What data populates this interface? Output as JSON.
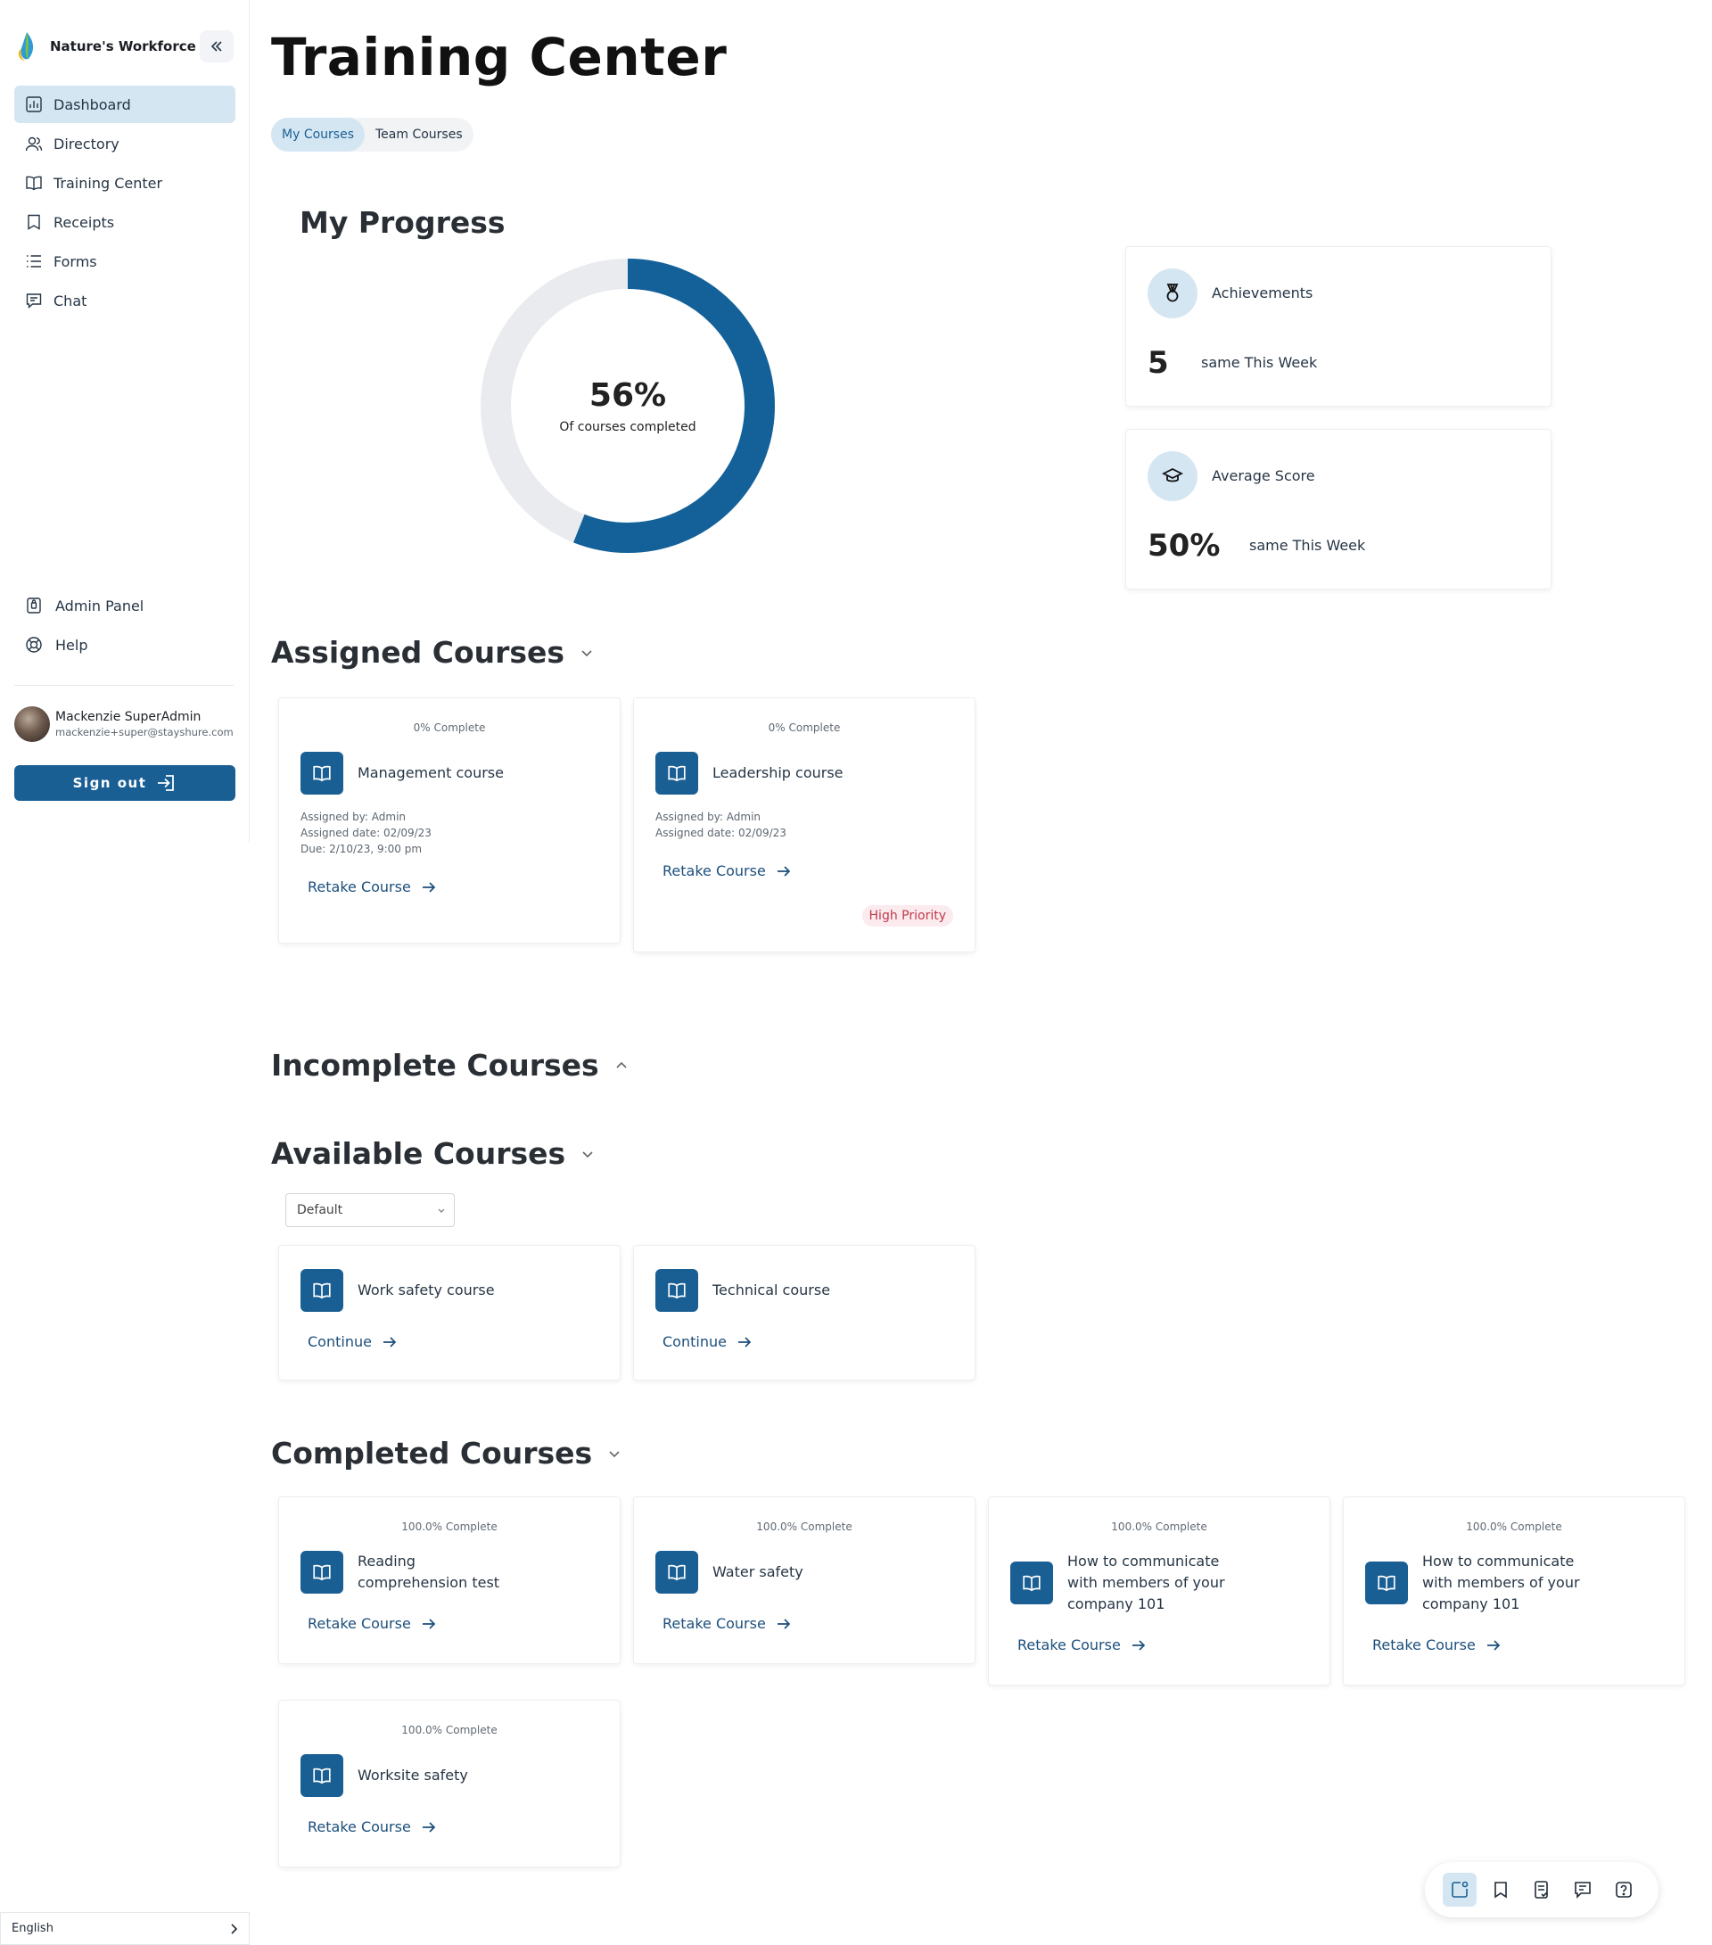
{
  "brand": {
    "name": "Nature's Workforce"
  },
  "sidebar": {
    "items": [
      {
        "label": "Dashboard",
        "icon": "dashboard-icon",
        "active": true
      },
      {
        "label": "Directory",
        "icon": "users-icon"
      },
      {
        "label": "Training Center",
        "icon": "book-open-icon"
      },
      {
        "label": "Receipts",
        "icon": "receipt-icon"
      },
      {
        "label": "Forms",
        "icon": "list-icon"
      },
      {
        "label": "Chat",
        "icon": "chat-icon"
      }
    ],
    "bottom_items": [
      {
        "label": "Admin Panel",
        "icon": "admin-icon"
      },
      {
        "label": "Help",
        "icon": "lifebuoy-icon"
      }
    ]
  },
  "user": {
    "name": "Mackenzie SuperAdmin",
    "email": "mackenzie+super@stayshure.com"
  },
  "signout": {
    "label": "Sign out"
  },
  "language": {
    "label": "English"
  },
  "page": {
    "title": "Training Center"
  },
  "tabs": [
    {
      "label": "My Courses",
      "active": true
    },
    {
      "label": "Team Courses",
      "active": false
    }
  ],
  "progress": {
    "title": "My Progress",
    "percent": 56,
    "percent_label": "56%",
    "caption": "Of courses completed",
    "color_fill": "#14619a",
    "color_track": "#e9ebee"
  },
  "stats": {
    "achievements": {
      "label": "Achievements",
      "value": "5",
      "delta": "same  This Week",
      "icon": "medal-icon"
    },
    "average_score": {
      "label": "Average Score",
      "value": "50%",
      "delta": "same  This Week",
      "icon": "graduation-cap-icon"
    }
  },
  "sections": {
    "assigned": "Assigned Courses",
    "incomplete": "Incomplete Courses",
    "available": "Available Courses",
    "completed": "Completed  Courses"
  },
  "assigned_courses": [
    {
      "pct": "0% Complete",
      "title": "Management course",
      "assigned_by": "Assigned by: Admin",
      "assigned_date": "Assigned date: 02/09/23",
      "due": "Due: 2/10/23, 9:00 pm",
      "link": "Retake Course"
    },
    {
      "pct": "0% Complete",
      "title": "Leadership course",
      "assigned_by": "Assigned by: Admin",
      "assigned_date": "Assigned date: 02/09/23",
      "link": "Retake Course",
      "badge": "High Priority"
    }
  ],
  "available_filter": {
    "selected": "Default"
  },
  "available_courses": [
    {
      "title": "Work safety course",
      "link": "Continue"
    },
    {
      "title": "Technical course",
      "link": "Continue"
    }
  ],
  "completed_courses": [
    {
      "pct": "100.0% Complete",
      "title": "Reading comprehension test",
      "link": "Retake Course"
    },
    {
      "pct": "100.0% Complete",
      "title": "Water safety",
      "link": "Retake Course"
    },
    {
      "pct": "100.0% Complete",
      "title": "How to communicate with members of your company 101",
      "link": "Retake Course"
    },
    {
      "pct": "100.0% Complete",
      "title": "How to communicate with members of your company 101",
      "link": "Retake Course"
    },
    {
      "pct": "100.0% Complete",
      "title": "Worksite safety",
      "link": "Retake Course"
    }
  ],
  "toolbar": {
    "tools": [
      {
        "icon": "new-note-icon",
        "active": true
      },
      {
        "icon": "bookmark-icon"
      },
      {
        "icon": "checklist-icon"
      },
      {
        "icon": "message-icon"
      },
      {
        "icon": "help-icon"
      }
    ]
  },
  "colors": {
    "accent": "#1a5f94",
    "accent_light": "#d5e6f3",
    "priority": "#c0394d"
  }
}
